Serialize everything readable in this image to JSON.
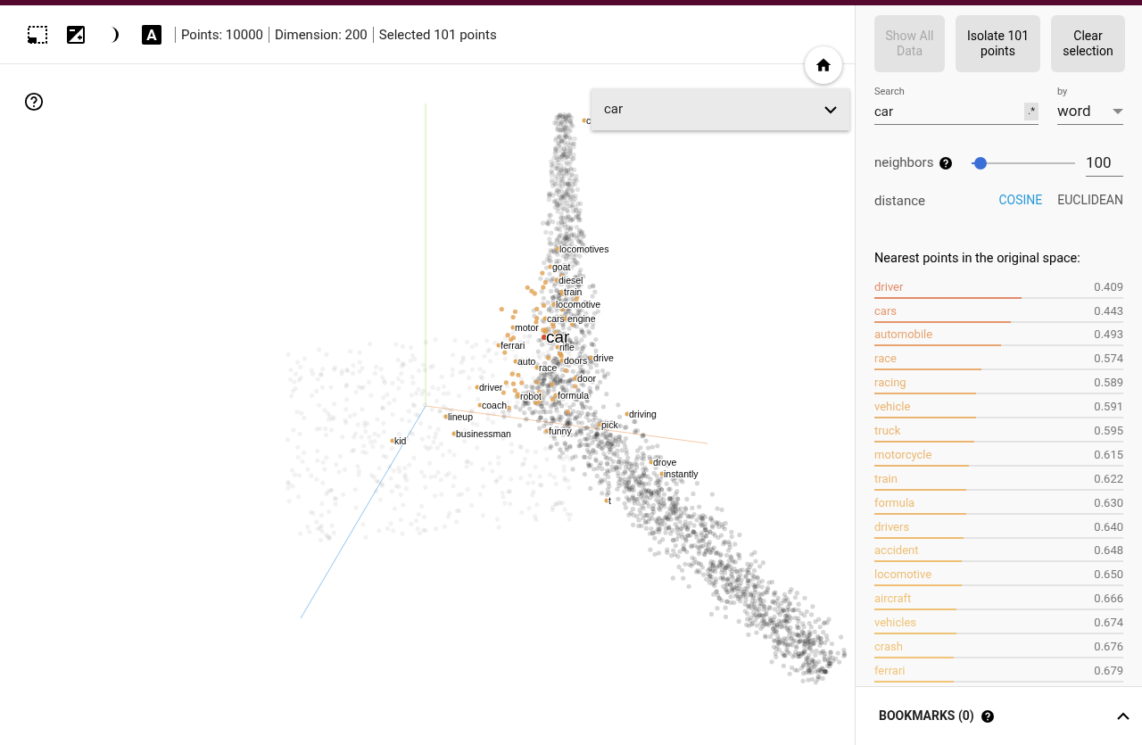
{
  "toolbar": {
    "label_toggle": "A",
    "stats": [
      "Points: 10000",
      "Dimension: 200",
      "Selected 101 points"
    ]
  },
  "plot": {
    "labels": [
      {
        "text": "c",
        "kind": "point"
      },
      {
        "text": "locomotives",
        "kind": "point"
      },
      {
        "text": "goat",
        "kind": "point"
      },
      {
        "text": "diesel",
        "kind": "point"
      },
      {
        "text": "train",
        "kind": "point"
      },
      {
        "text": "locomotive",
        "kind": "point"
      },
      {
        "text": "cars",
        "kind": "point"
      },
      {
        "text": "engine",
        "kind": "point"
      },
      {
        "text": "motor",
        "kind": "point"
      },
      {
        "text": "car",
        "kind": "query"
      },
      {
        "text": "ferrari",
        "kind": "point"
      },
      {
        "text": "rifle",
        "kind": "point"
      },
      {
        "text": "auto",
        "kind": "point"
      },
      {
        "text": "doors",
        "kind": "point"
      },
      {
        "text": "drive",
        "kind": "point"
      },
      {
        "text": "race",
        "kind": "point"
      },
      {
        "text": "door",
        "kind": "point"
      },
      {
        "text": "driver",
        "kind": "point"
      },
      {
        "text": "robot",
        "kind": "point"
      },
      {
        "text": "formula",
        "kind": "point"
      },
      {
        "text": "coach",
        "kind": "point"
      },
      {
        "text": "driving",
        "kind": "point"
      },
      {
        "text": "lineup",
        "kind": "point"
      },
      {
        "text": "pick",
        "kind": "point"
      },
      {
        "text": "kid",
        "kind": "point"
      },
      {
        "text": "businessman",
        "kind": "point"
      },
      {
        "text": "funny",
        "kind": "point"
      },
      {
        "text": "drove",
        "kind": "point"
      },
      {
        "text": "instantly",
        "kind": "point"
      },
      {
        "text": "t",
        "kind": "point"
      }
    ]
  },
  "selected_point": {
    "value": "car"
  },
  "panel": {
    "buttons": [
      {
        "label": "Show All Data",
        "disabled": true
      },
      {
        "label": "Isolate 101 points",
        "disabled": false
      },
      {
        "label": "Clear selection",
        "disabled": false
      }
    ],
    "search": {
      "label": "Search",
      "value": "car",
      "regex_toggle": ".*"
    },
    "by": {
      "label": "by",
      "value": "word"
    },
    "neighbors": {
      "label": "neighbors",
      "level": 0.08,
      "value": "100"
    },
    "distance": {
      "label": "distance",
      "options": [
        {
          "label": "COSINE",
          "selected": true
        },
        {
          "label": "EUCLIDEAN",
          "selected": false
        }
      ]
    },
    "nearest_title": "Nearest points in the original space:",
    "nearest": [
      {
        "word": "driver",
        "value": "0.409",
        "level": 0.59,
        "color": "#e38c6c"
      },
      {
        "word": "cars",
        "value": "0.443",
        "level": 0.55,
        "color": "#e5976e"
      },
      {
        "word": "automobile",
        "value": "0.493",
        "level": 0.51,
        "color": "#e7a470"
      },
      {
        "word": "race",
        "value": "0.574",
        "level": 0.43,
        "color": "#e9ad70"
      },
      {
        "word": "racing",
        "value": "0.589",
        "level": 0.41,
        "color": "#eab270"
      },
      {
        "word": "vehicle",
        "value": "0.591",
        "level": 0.41,
        "color": "#ebb470"
      },
      {
        "word": "truck",
        "value": "0.595",
        "level": 0.4,
        "color": "#ebb571"
      },
      {
        "word": "motorcycle",
        "value": "0.615",
        "level": 0.38,
        "color": "#ecb872"
      },
      {
        "word": "train",
        "value": "0.622",
        "level": 0.37,
        "color": "#ecba72"
      },
      {
        "word": "formula",
        "value": "0.630",
        "level": 0.37,
        "color": "#edbb73"
      },
      {
        "word": "drivers",
        "value": "0.640",
        "level": 0.36,
        "color": "#edbd73"
      },
      {
        "word": "accident",
        "value": "0.648",
        "level": 0.35,
        "color": "#eebf74"
      },
      {
        "word": "locomotive",
        "value": "0.650",
        "level": 0.35,
        "color": "#eebf74"
      },
      {
        "word": "aircraft",
        "value": "0.666",
        "level": 0.33,
        "color": "#efc275"
      },
      {
        "word": "vehicles",
        "value": "0.674",
        "level": 0.33,
        "color": "#efc376"
      },
      {
        "word": "crash",
        "value": "0.676",
        "level": 0.32,
        "color": "#f0c476"
      },
      {
        "word": "ferrari",
        "value": "0.679",
        "level": 0.32,
        "color": "#f0c577"
      }
    ],
    "bookmarks": "BOOKMARKS (0)"
  }
}
